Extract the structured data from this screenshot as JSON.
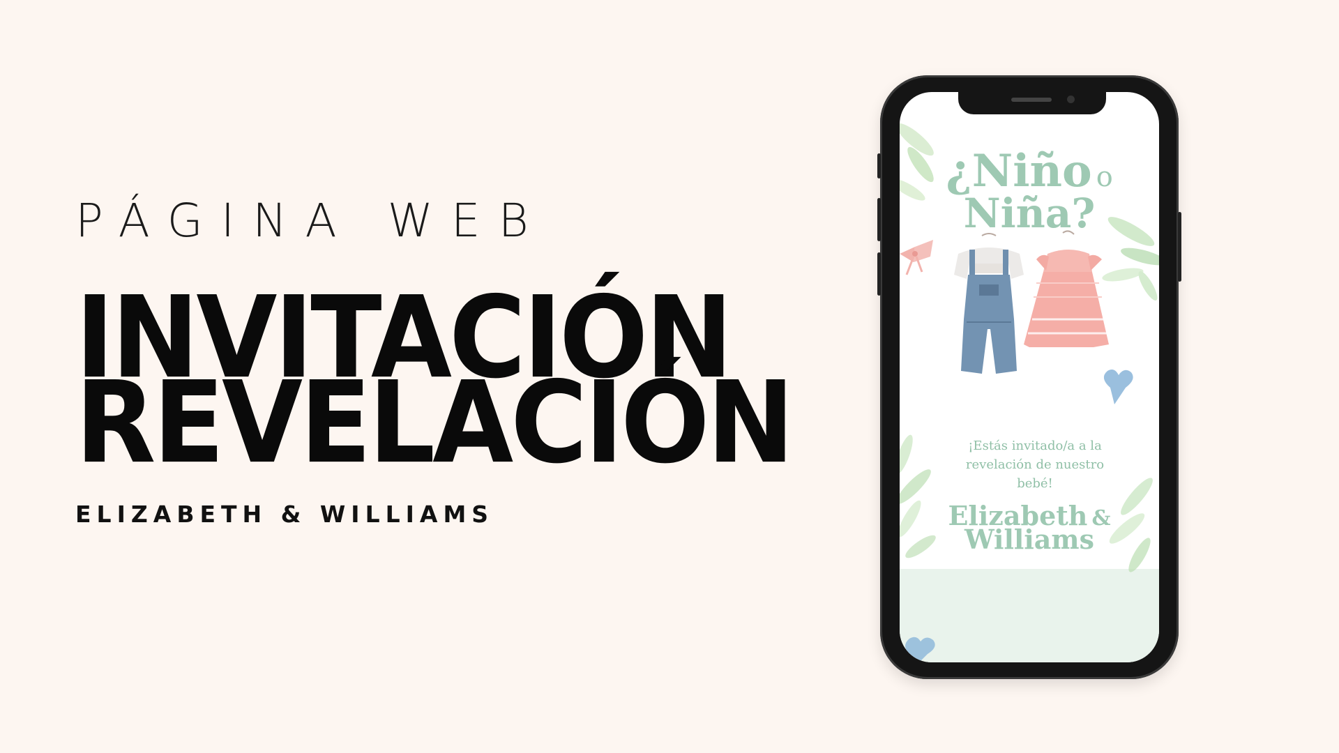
{
  "headline": {
    "kicker": "PÁGINA WEB",
    "line1": "INVITACIÓN",
    "line2": "REVELACIÓN",
    "couple": "ELIZABETH & WILLIAMS"
  },
  "invitation": {
    "title_line1_a": "¿Niño",
    "title_line1_b": "o",
    "title_line2": "Niña?",
    "message_line1": "¡Estás invitado/a a la",
    "message_line2": "revelación de nuestro",
    "message_line3": "bebé!",
    "names_line1_a": "Elizabeth",
    "names_line1_b": "&",
    "names_line2": "Williams"
  },
  "icons": {
    "leaves": "leaf-icon",
    "bow": "bow-icon",
    "heart": "heart-icon",
    "overalls": "baby-overalls-icon",
    "dress": "baby-dress-icon"
  },
  "colors": {
    "background": "#fdf6f1",
    "text": "#0a0a0a",
    "mint": "#9ec9b3",
    "pink": "#f0a9a3",
    "denim": "#6f8fae",
    "heart_blue": "#8fb8da"
  }
}
